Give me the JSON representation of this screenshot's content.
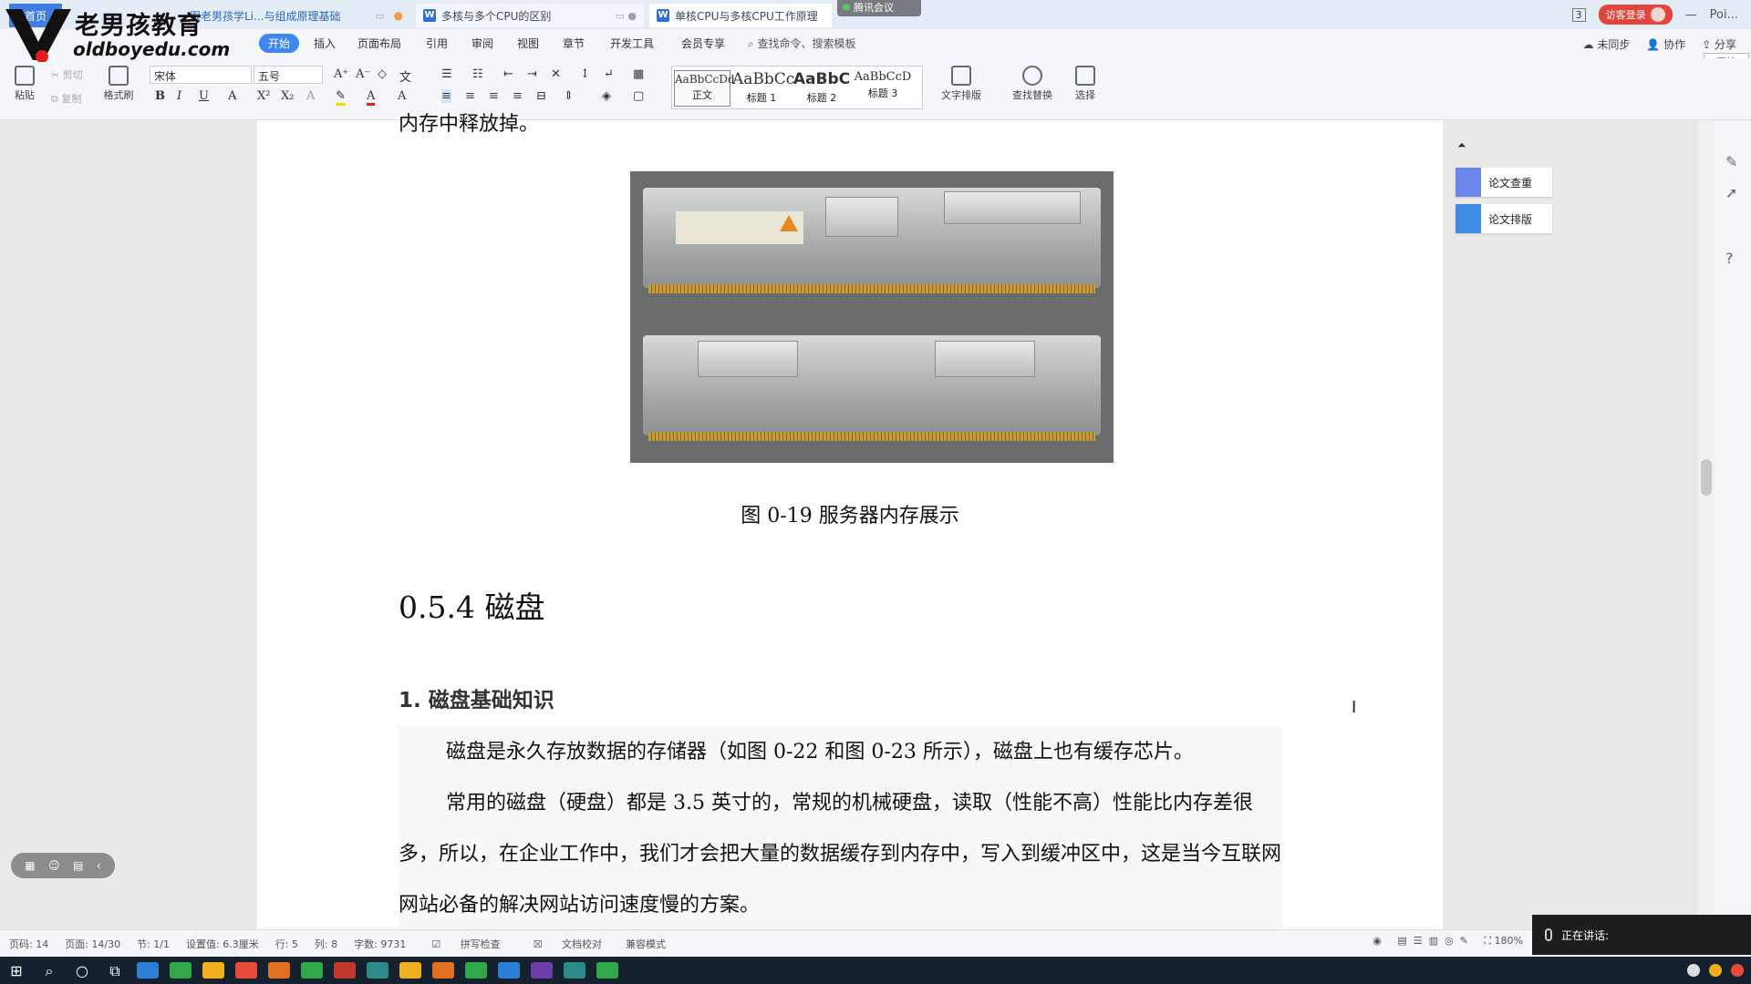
{
  "window": {
    "tabs": [
      {
        "label": "首页"
      },
      {
        "label": "跟老男孩学Li...与组成原理基础"
      },
      {
        "label": "多核与多个CPU的区别"
      },
      {
        "label": "单核CPU与多核CPU工作原理"
      }
    ],
    "meeting_badge": "腾讯会议",
    "page_count_badge": "3",
    "visitor_login": "访客登录",
    "partial_text": "Poi..."
  },
  "watermark": {
    "brand": "老男孩教育",
    "url": "oldboyedu.com"
  },
  "menu": {
    "items": [
      "开始",
      "插入",
      "页面布局",
      "引用",
      "审阅",
      "视图",
      "章节",
      "开发工具",
      "会员专享"
    ],
    "search": "查找命令、搜索模板",
    "right": [
      "未同步",
      "协作",
      "分享"
    ],
    "start_button": "开始"
  },
  "ribbon": {
    "paste": "粘贴",
    "cut": "剪切",
    "copy": "复制",
    "format_painter": "格式刷",
    "font": "宋体",
    "font_size": "五号",
    "styles": [
      {
        "sample": "AaBbCcDd",
        "name": "正文"
      },
      {
        "sample": "AaBbCc",
        "name": "标题 1"
      },
      {
        "sample": "AaBbC",
        "name": "标题 2"
      },
      {
        "sample": "AaBbCcD",
        "name": "标题 3"
      }
    ],
    "text_layout": "文字排版",
    "find_replace": "查找替换",
    "select": "选择"
  },
  "document": {
    "prev_line": "内存中释放掉。",
    "figure_caption": "图 0-19  服务器内存展示",
    "section_heading": "0.5.4  磁盘",
    "subsection_heading": "1.   磁盘基础知识",
    "paragraph1": "磁盘是永久存放数据的存储器（如图 0-22 和图 0-23 所示），磁盘上也有缓存芯片。",
    "paragraph2": "常用的磁盘（硬盘）都是 3.5 英寸的，常规的机械硬盘，读取（性能不高）性能比内存差很多，所以，在企业工作中，我们才会把大量的数据缓存到内存中，写入到缓冲区中，这是当今互联网网站必备的解决网站访问速度慢的方案。"
  },
  "side_panel": {
    "check": "论文查重",
    "layout": "论文排版"
  },
  "status": {
    "page_code": "页码: 14",
    "page": "页面: 14/30",
    "section": "节: 1/1",
    "position": "设置值: 6.3厘米",
    "row": "行: 5",
    "col": "列: 8",
    "word_count": "字数: 9731",
    "spell_check": "拼写检查",
    "doc_proof": "文档校对",
    "compat_mode": "兼容模式",
    "zoom": "180%"
  },
  "speaking": "正在讲话:"
}
